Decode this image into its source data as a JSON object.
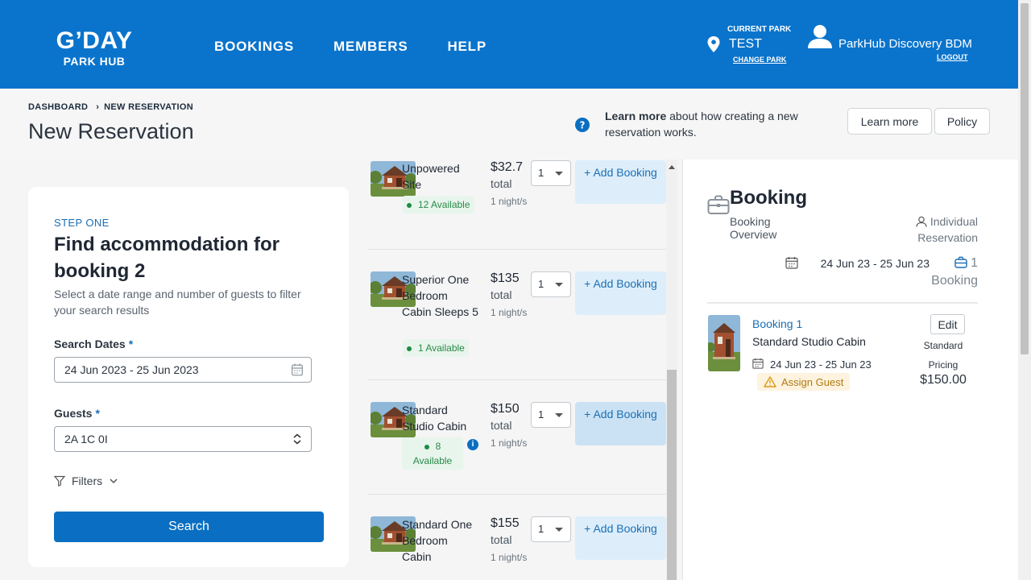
{
  "header": {
    "logo_line1": "G’DAY",
    "logo_line2": "PARK HUB",
    "nav": [
      "BOOKINGS",
      "MEMBERS",
      "HELP"
    ],
    "current_park_label": "CURRENT PARK",
    "current_park": "TEST",
    "change_park": "CHANGE PARK",
    "user_name": "ParkHub Discovery BDM",
    "logout": "LOGOUT"
  },
  "breadcrumb": {
    "items": [
      "DASHBOARD",
      "NEW RESERVATION"
    ],
    "separator": "›"
  },
  "page_title": "New Reservation",
  "learn": {
    "bold": "Learn more",
    "text": " about how creating a new reservation works.",
    "learn_more_button": "Learn more",
    "policy_button": "Policy"
  },
  "search": {
    "step": "STEP ONE",
    "title": "Find accommodation for booking 2",
    "subtitle": "Select a date range and number of guests to filter your search results",
    "dates_label": "Search Dates",
    "dates_value": "24 Jun 2023 - 25 Jun 2023",
    "guests_label": "Guests",
    "guests_value": "2A 1C 0I",
    "required_mark": "*",
    "filters": "Filters",
    "search_button": "Search"
  },
  "results": [
    {
      "name": "Unpowered Site",
      "available": "12 Available",
      "price": "$32.7",
      "total": "total",
      "nights": "1 night/s",
      "qty": "1",
      "add": "+ Add Booking"
    },
    {
      "name": "Superior One Bedroom Cabin Sleeps 5",
      "available": "1 Available",
      "price": "$135",
      "total": "total",
      "nights": "1 night/s",
      "qty": "1",
      "add": "+ Add Booking"
    },
    {
      "name": "Standard Studio Cabin",
      "available": "8 Available",
      "price": "$150",
      "total": "total",
      "nights": "1 night/s",
      "qty": "1",
      "add": "+ Add Booking"
    },
    {
      "name": "Standard One Bedroom Cabin",
      "available": "",
      "price": "$155",
      "total": "total",
      "nights": "1 night/s",
      "qty": "1",
      "add": "+ Add Booking"
    }
  ],
  "booking": {
    "title": "Booking",
    "overview": "Booking Overview",
    "type": "Individual Reservation",
    "dates": "24 Jun 23 - 25 Jun 23",
    "count": "1 Booking",
    "item": {
      "label": "Booking 1",
      "cabin": "Standard Studio Cabin",
      "dates": "24 Jun 23 - 25 Jun 23",
      "assign": "Assign Guest",
      "edit": "Edit",
      "pricing": "Standard Pricing",
      "amount": "$150.00"
    }
  },
  "colors": {
    "brand": "#0a74cc",
    "accent": "#1a6fb5",
    "available": "#2a8a4a",
    "warning": "#b07a10"
  }
}
